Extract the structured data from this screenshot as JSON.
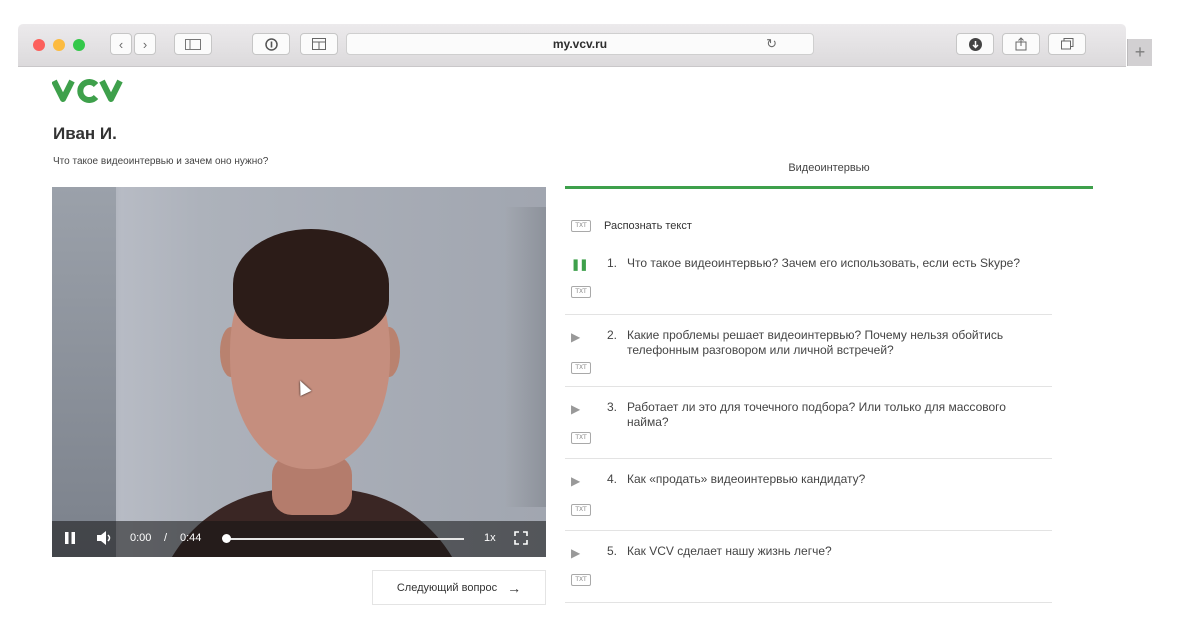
{
  "browser": {
    "url": "my.vcv.ru",
    "new_tab_label": "+",
    "colors": {
      "close": "#fc605c",
      "minimize": "#fcbb40",
      "zoom": "#34c84a"
    }
  },
  "page": {
    "logo": "VCV",
    "candidate_name": "Иван И.",
    "video_question": "Что такое видеоинтервью и зачем оно нужно?",
    "player": {
      "current_time": "0:00",
      "separator": "/",
      "duration": "0:44",
      "speed": "1x",
      "progress": 0
    },
    "next_button_label": "Следующий вопрос",
    "next_arrow": "→"
  },
  "panel": {
    "tab_label": "Видеоинтервью",
    "txt_icon_label": "TXT",
    "recognize_label": "Распознать текст",
    "questions": [
      {
        "num": "1.",
        "text": "Что такое видеоинтервью? Зачем его использовать, если есть Skype?",
        "state": "playing"
      },
      {
        "num": "2.",
        "text": "Какие проблемы решает видеоинтервью? Почему нельзя обойтись телефонным разговором или личной встречей?",
        "state": "idle"
      },
      {
        "num": "3.",
        "text": "Работает ли это для точечного подбора? Или только для массового найма?",
        "state": "idle"
      },
      {
        "num": "4.",
        "text": "Как «продать» видеоинтервью кандидату?",
        "state": "idle"
      },
      {
        "num": "5.",
        "text": "Как VCV сделает нашу жизнь легче?",
        "state": "idle"
      }
    ]
  },
  "theme": {
    "accent": "#3ea04b"
  }
}
